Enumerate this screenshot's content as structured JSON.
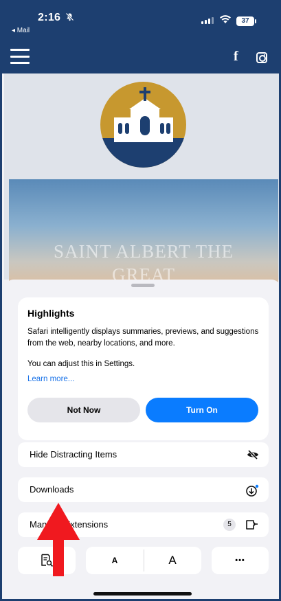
{
  "status_bar": {
    "time": "2:16",
    "back_app": "◂ Mail",
    "battery": "37"
  },
  "site": {
    "hero_title_line1": "SAINT ALBERT THE",
    "hero_title_line2": "GREAT"
  },
  "highlights": {
    "title": "Highlights",
    "body": "Safari intelligently displays summaries, previews, and suggestions from the web, nearby locations, and more.",
    "note": "You can adjust this in Settings.",
    "learn_more": "Learn more...",
    "not_now": "Not Now",
    "turn_on": "Turn On"
  },
  "menu": {
    "hide_distracting": "Hide Distracting Items",
    "downloads": "Downloads",
    "manage_extensions": "Manage Extensions",
    "extensions_count": "5"
  },
  "toolbar": {
    "font_small": "A",
    "font_large": "A",
    "more": "•••"
  },
  "colors": {
    "site_blue": "#1d3f70",
    "logo_gold": "#c7982f",
    "accent_blue": "#0a7cff",
    "annotation_red": "#f0191f"
  }
}
